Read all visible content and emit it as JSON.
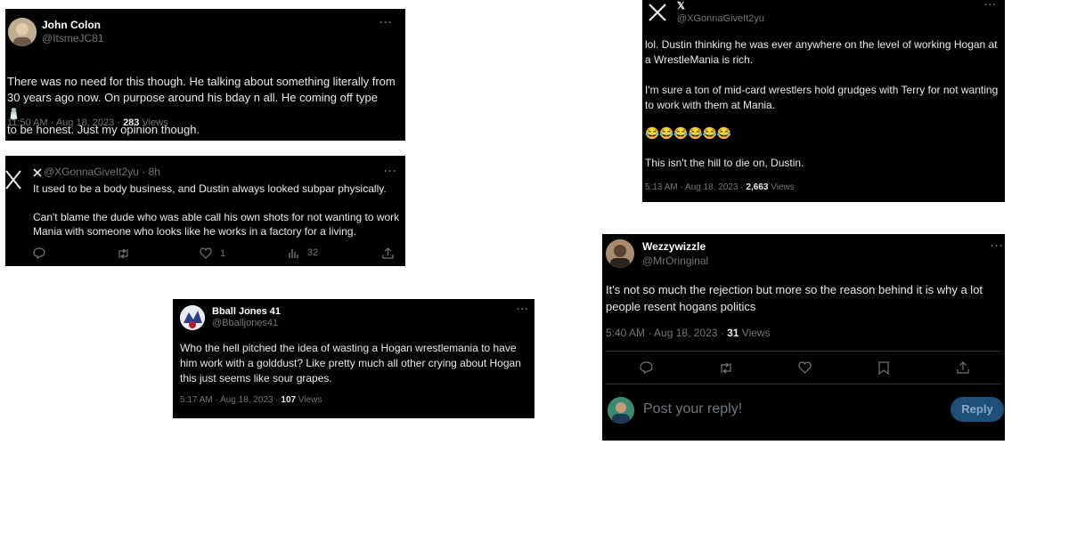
{
  "tweet_john": {
    "name": "John Colon",
    "handle": "@ItsmeJC81",
    "text": "There was no need for this though. He talking about something literally from 30 years ago now. On purpose around his bday n all. He coming off type",
    "emoji": "🧂",
    "text_after": "to be honest. Just my opinion though.",
    "time": "11:50 AM · Aug 18, 2023 · ",
    "views_count": "283",
    "views_label": " Views"
  },
  "tweet_x_quote": {
    "handle_time": "@XGonnaGiveIt2yu · 8h",
    "text": "It used to be a body business, and Dustin always looked subpar physically.\n\nCan't blame the dude who was able call his own shots for not wanting to work Mania with someone who looks like he works in a factory for a living.",
    "likes": "1",
    "views": "32"
  },
  "tweet_bball": {
    "name": "Bball Jones 41",
    "handle": "@Bballjones41",
    "text": "Who the hell pitched the idea of wasting a Hogan wrestlemania to have him work with a golddust? Like pretty much all other crying about Hogan this just seems like sour grapes.",
    "time": "5:17 AM · Aug 18, 2023 · ",
    "views_count": "107",
    "views_label": " Views"
  },
  "tweet_x_main": {
    "name": "𝕏",
    "handle": "@XGonnaGiveIt2yu",
    "text": "lol.  Dustin thinking he was ever anywhere on the level of working Hogan at a WrestleMania is rich.\n\nI'm sure a ton of mid-card wrestlers hold grudges with Terry for not wanting to work with them at Mania.",
    "emojis": "😂😂😂😂😂😂",
    "text_end": "This isn't the hill to die on, Dustin.",
    "time": "5:13 AM · Aug 18, 2023 · ",
    "views_count": "2,663",
    "views_label": " Views"
  },
  "tweet_wezzy": {
    "name": "Wezzywizzle",
    "handle": "@MrOringinal",
    "text": "It's not so much the rejection but more so the reason behind it is why a lot people resent hogans politics",
    "time": "5:40 AM · Aug 18, 2023 · ",
    "views_count": "31",
    "views_label": " Views",
    "reply_placeholder": "Post your reply!",
    "reply_button": "Reply"
  },
  "more_glyph": "···",
  "colors": {
    "background": "#000000",
    "text": "#e7e9ea",
    "muted": "#71767b",
    "reply_button": "#1d4f78"
  }
}
